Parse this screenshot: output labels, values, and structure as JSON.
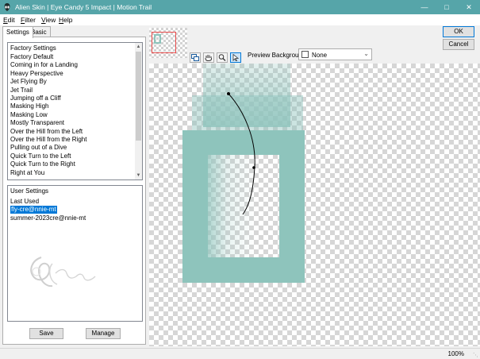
{
  "window": {
    "title": "Alien Skin | Eye Candy 5 Impact | Motion Trail",
    "title_color": "#56a5a9"
  },
  "menu": [
    {
      "key": "E",
      "rest": "dit"
    },
    {
      "key": "F",
      "rest": "ilter"
    },
    {
      "key": "V",
      "rest": "iew"
    },
    {
      "key": "H",
      "rest": "elp"
    }
  ],
  "tabs": {
    "settings": "Settings",
    "basic": "Basic"
  },
  "factory_settings": {
    "header": "Factory Settings",
    "items": [
      "Factory Default",
      "Coming in for a Landing",
      "Heavy Perspective",
      "Jet Flying By",
      "Jet Trail",
      "Jumping off a Cliff",
      "Masking High",
      "Masking Low",
      "Mostly Transparent",
      "Over the Hill from the Left",
      "Over the Hill from the Right",
      "Pulling out of a Dive",
      "Quick Turn to the Left",
      "Quick Turn to the Right",
      "Right at You"
    ]
  },
  "user_settings": {
    "header": "User Settings",
    "items": [
      "Last Used",
      "fly-cre@nnie-mt",
      "summer-2023cre@nnie-mt"
    ],
    "selected_index": 1,
    "watermark": "Sylviane"
  },
  "buttons": {
    "save": "Save",
    "manage": "Manage",
    "ok": "OK",
    "cancel": "Cancel"
  },
  "preview": {
    "background_label": "Preview Background:",
    "background_value": "None",
    "tools": [
      "toggle-preview-icon",
      "hand-icon",
      "zoom-icon",
      "arrow-select-icon"
    ],
    "active_tool": "arrow-select-icon",
    "shape_color": "#8ec4bc",
    "path_color": "#000000"
  },
  "status": {
    "zoom": "100%"
  },
  "colors": {
    "accent": "#0078d7",
    "thumbnail_frame": "#e84a4a"
  }
}
